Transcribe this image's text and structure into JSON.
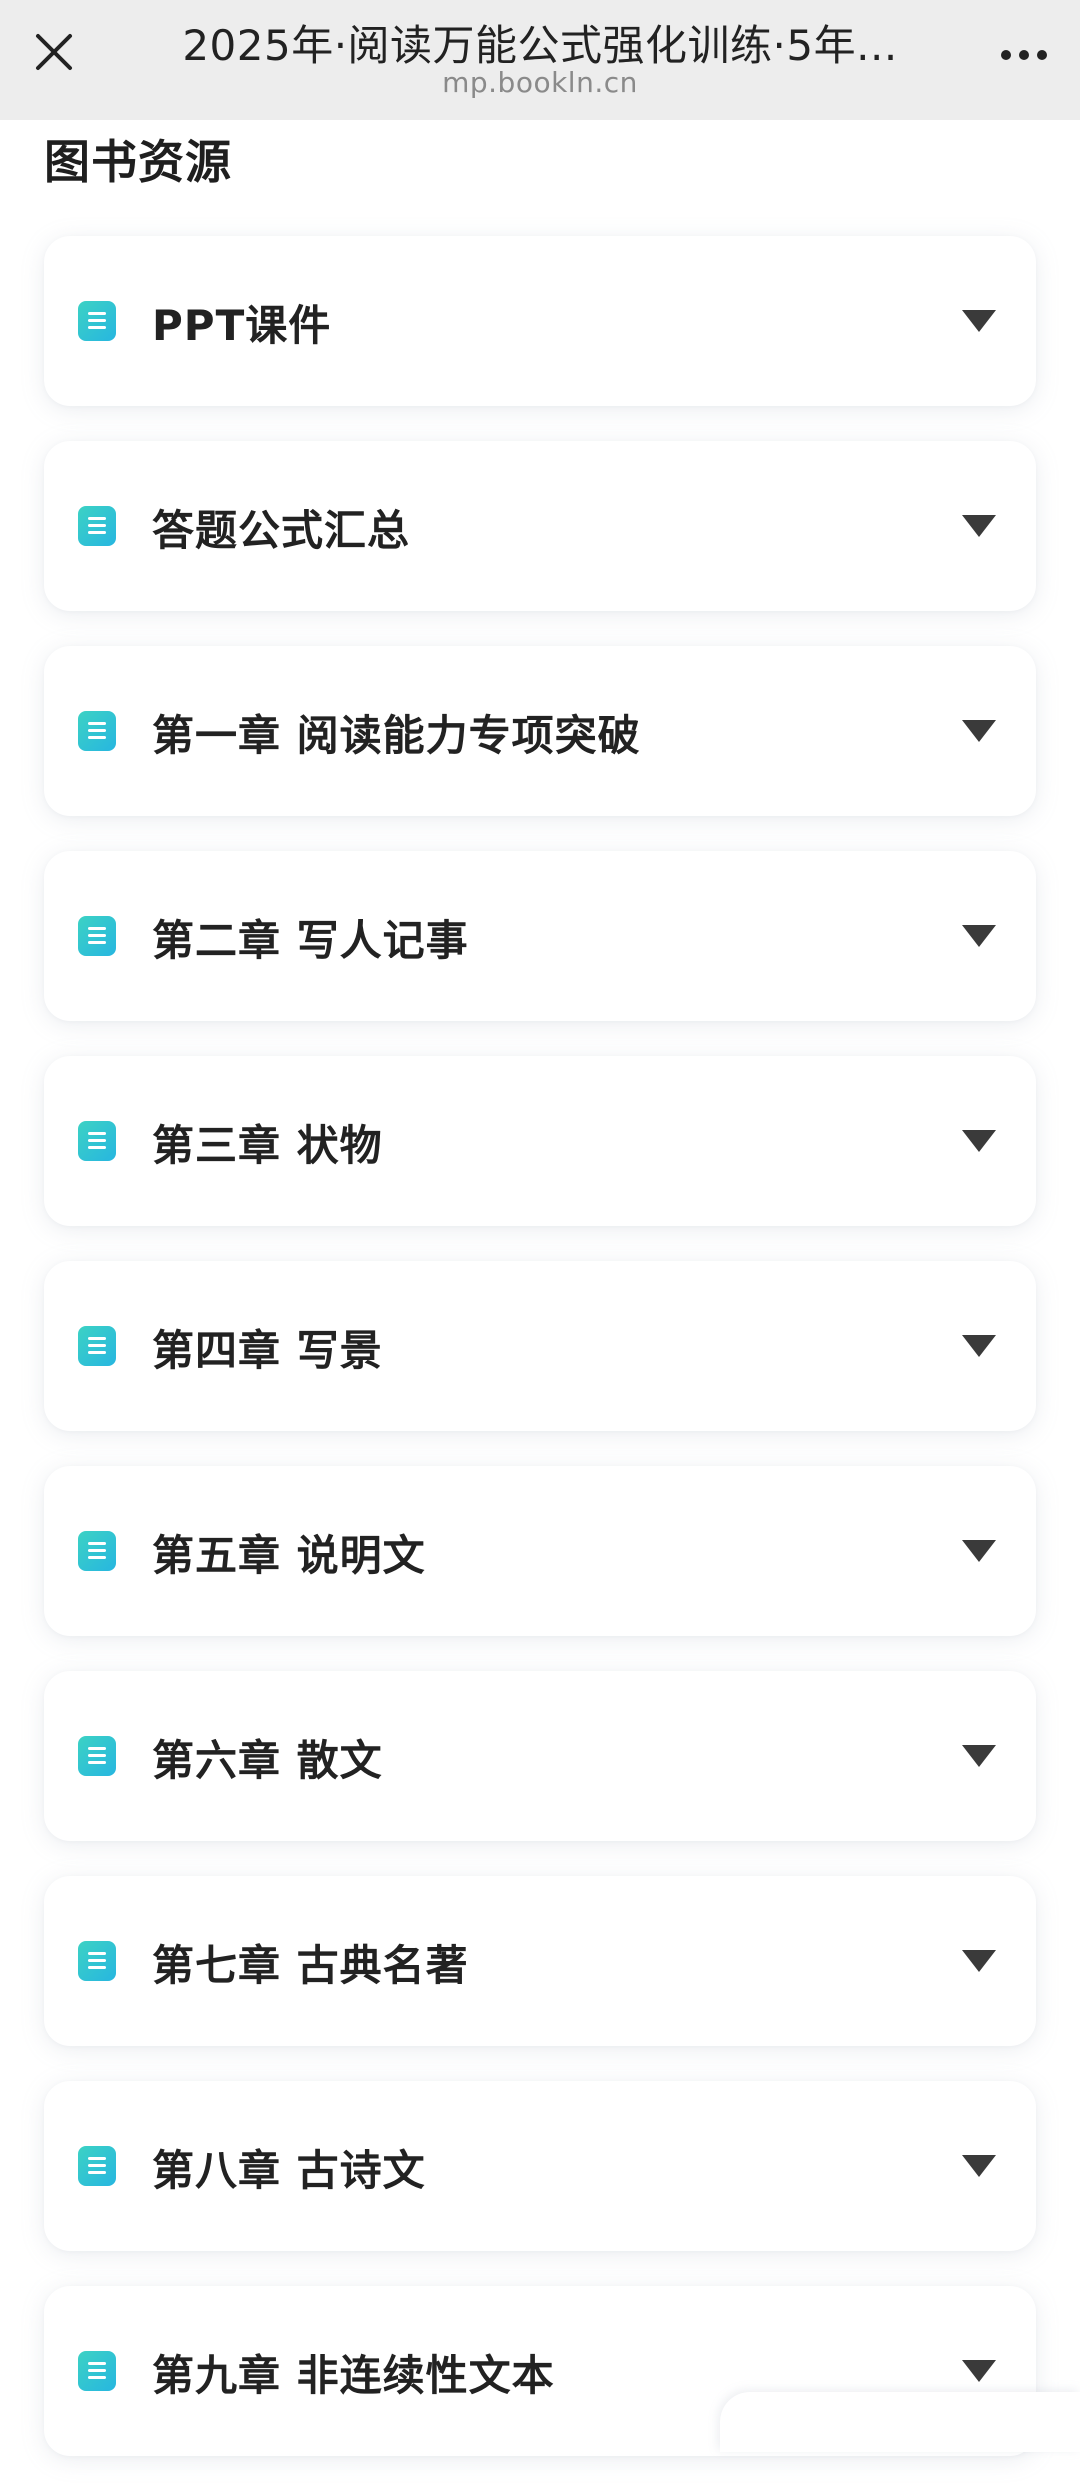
{
  "header": {
    "title": "2025年·阅读万能公式强化训练·5年...",
    "url": "mp.bookln.cn",
    "close_icon": "close-icon",
    "more_icon": "more-icon"
  },
  "section": {
    "title": "图书资源"
  },
  "resources": [
    {
      "label": "PPT课件"
    },
    {
      "label": "答题公式汇总"
    },
    {
      "label": "第一章 阅读能力专项突破"
    },
    {
      "label": "第二章 写人记事"
    },
    {
      "label": "第三章 状物"
    },
    {
      "label": "第四章 写景"
    },
    {
      "label": "第五章 说明文"
    },
    {
      "label": "第六章 散文"
    },
    {
      "label": "第七章 古典名著"
    },
    {
      "label": "第八章 古诗文"
    },
    {
      "label": "第九章 非连续性文本"
    }
  ],
  "colors": {
    "icon_gradient_start": "#3cd2c4",
    "icon_gradient_end": "#27b6e0",
    "title_highlight": "#bfeef0"
  }
}
